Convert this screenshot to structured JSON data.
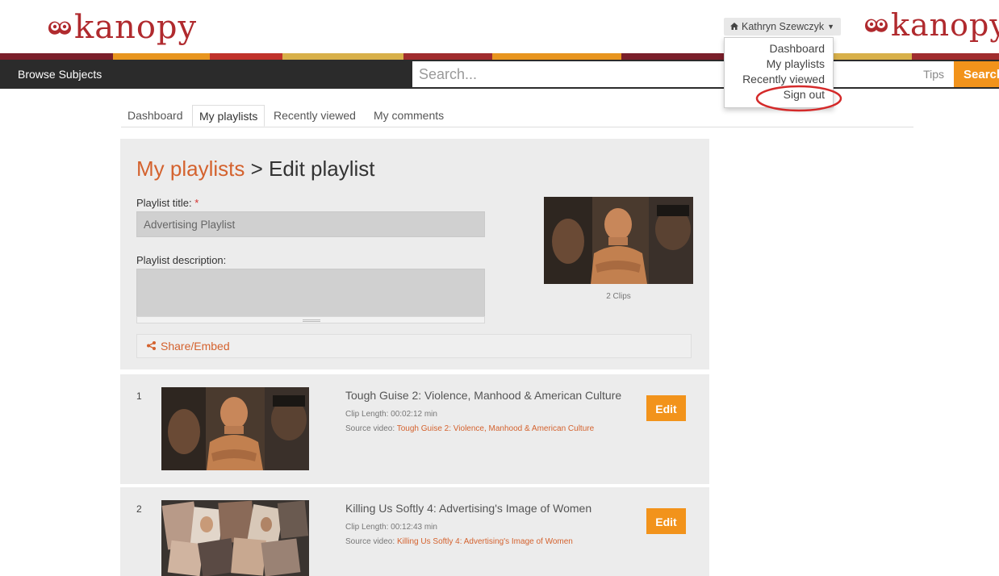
{
  "brand": {
    "logo_text": "kanopy",
    "stripe_colors": [
      "#c0322b",
      "#e8951f",
      "#7a1f2a",
      "#d8b04a",
      "#a02d2e"
    ]
  },
  "header": {
    "user_name": "Kathryn Szewczyk",
    "user_menu": [
      "Dashboard",
      "My playlists",
      "Recently viewed",
      "Sign out"
    ],
    "browse_label": "Browse Subjects",
    "search_placeholder": "Search...",
    "tips_label": "Tips",
    "search_button": "Search"
  },
  "tabs": [
    "Dashboard",
    "My playlists",
    "Recently viewed",
    "My comments"
  ],
  "edit": {
    "breadcrumb_link": "My playlists",
    "breadcrumb_rest": " > Edit playlist",
    "title_label": "Playlist title:",
    "required_mark": "*",
    "title_value": "Advertising Playlist",
    "description_label": "Playlist description:",
    "description_value": "",
    "share_label": "Share/Embed",
    "clip_count": "2 Clips"
  },
  "clips": [
    {
      "index": "1",
      "title": "Tough Guise 2: Violence, Manhood & American Culture",
      "length_label": "Clip Length: 00:02:12 min",
      "source_prefix": "Source video: ",
      "source_title": "Tough Guise 2: Violence, Manhood & American Culture",
      "edit_label": "Edit"
    },
    {
      "index": "2",
      "title": "Killing Us Softly 4: Advertising's Image of Women",
      "length_label": "Clip Length: 00:12:43 min",
      "source_prefix": "Source video: ",
      "source_title": "Killing Us Softly 4: Advertising's Image of Women",
      "edit_label": "Edit"
    }
  ],
  "colors": {
    "accent": "#d4622e",
    "button": "#f2931b",
    "brand_red": "#b02a2e",
    "navbar": "#2b2b2b",
    "highlight_ring": "#d42a2a"
  }
}
